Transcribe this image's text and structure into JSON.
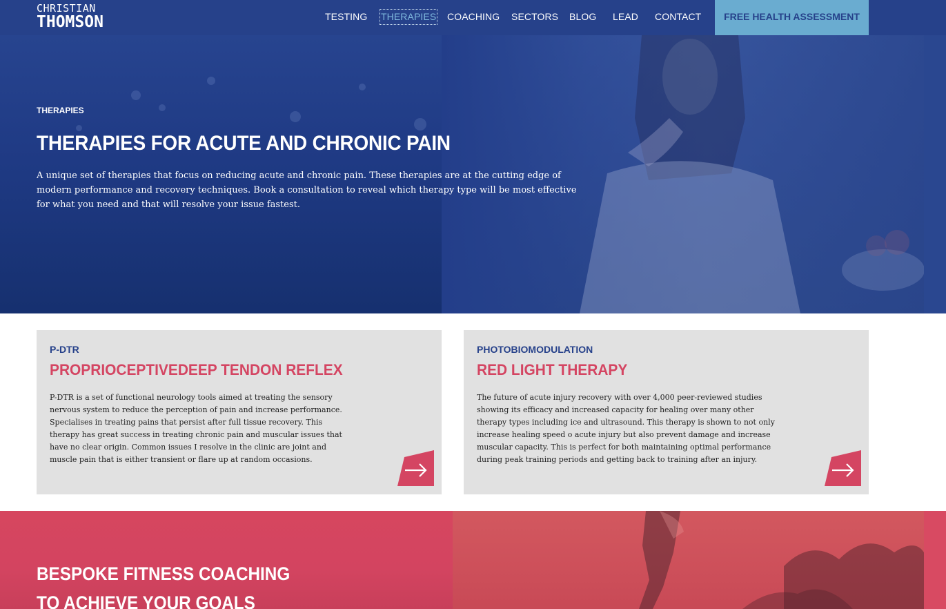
{
  "logo": {
    "line1": "CHRISTIAN",
    "line2": "THOMSON"
  },
  "nav": {
    "items": [
      {
        "label": "TESTING"
      },
      {
        "label": "THERAPIES"
      },
      {
        "label": "COACHING"
      },
      {
        "label": "SECTORS"
      },
      {
        "label": "BLOG"
      },
      {
        "label": "LEAD"
      },
      {
        "label": "CONTACT"
      }
    ],
    "active": "THERAPIES",
    "cta_label": "FREE HEALTH ASSESSMENT"
  },
  "hero": {
    "kicker": "THERAPIES",
    "title": "THERAPIES FOR ACUTE AND CHRONIC PAIN",
    "description": "A unique set of therapies that focus on reducing acute and chronic pain. These therapies are at the cutting edge of modern performance and recovery techniques. Book a consultation to reveal which therapy type will be most effective for what you need and that will resolve your issue fastest."
  },
  "cards": [
    {
      "kicker": "P-DTR",
      "title": "PROPRIOCEPTIVEDEEP TENDON REFLEX",
      "body": "P-DTR is a set of functional neurology tools aimed at treating the sensory nervous system to reduce the perception of pain and increase performance. Specialises in treating pains that persist after full tissue recovery. This therapy has great success in treating chronic pain and muscular issues that have no clear origin. Common issues I resolve in the clinic are joint and muscle pain that is either transient or flare up at random occasions.",
      "arrow_icon": "arrow-right-icon"
    },
    {
      "kicker": "PHOTOBIOMODULATION",
      "title": "RED LIGHT THERAPY",
      "body": "The future of acute injury recovery with over 4,000 peer-reviewed studies showing its efficacy and increased capacity for healing over many other therapy types including ice and ultrasound. This therapy is shown to not only increase healing speed o acute injury but also prevent damage and increase muscular capacity. This is perfect for both maintaining optimal performance during peak training periods and getting back to training after an injury.",
      "arrow_icon": "arrow-right-icon"
    }
  ],
  "coaching": {
    "title_line1": "BESPOKE FITNESS COACHING",
    "title_line2": "TO ACHIEVE YOUR GOALS"
  },
  "colors": {
    "brand_blue": "#26418a",
    "accent_light_blue": "#6aacd0",
    "accent_red": "#d44562",
    "card_bg": "#e1e1e1"
  }
}
